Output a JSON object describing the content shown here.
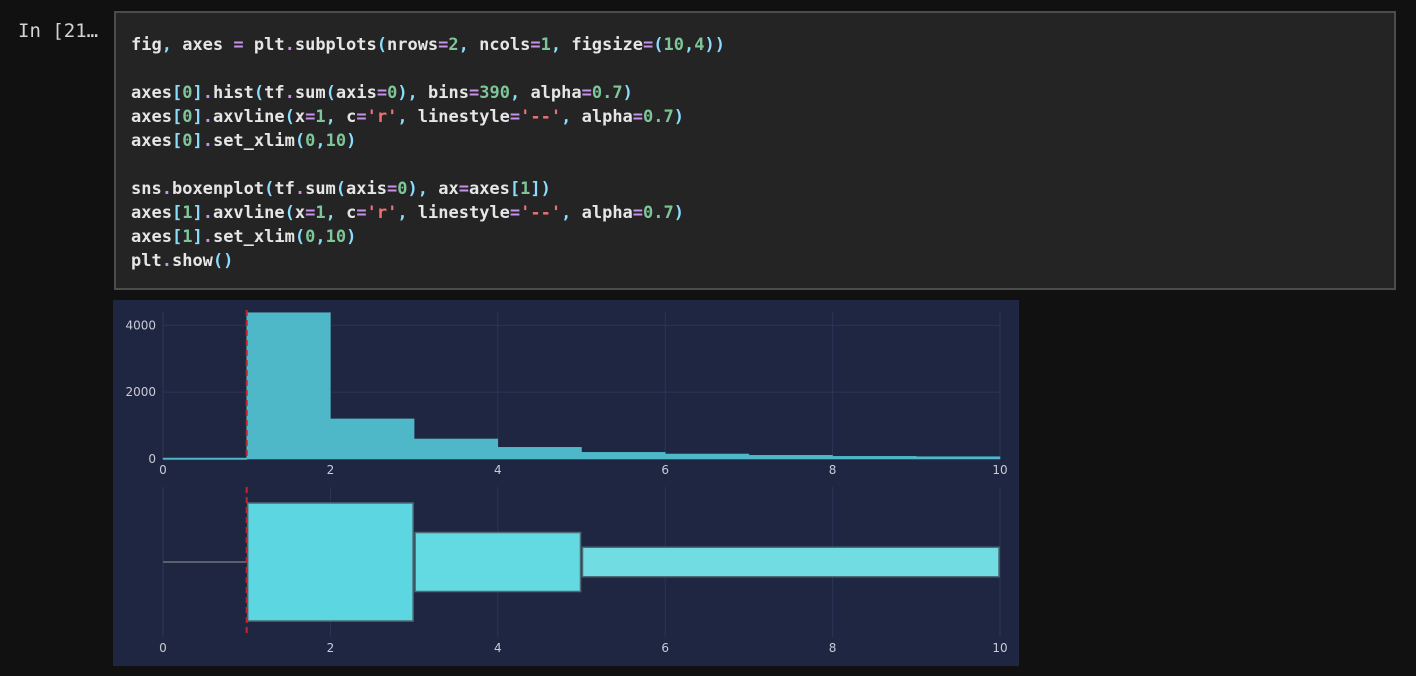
{
  "cell": {
    "prompt": "In [21…",
    "code_lines": [
      [
        [
          "v",
          "fig"
        ],
        [
          "p",
          ", "
        ],
        [
          "v",
          "axes "
        ],
        [
          "o",
          "="
        ],
        [
          "v",
          " plt"
        ],
        [
          "o",
          "."
        ],
        [
          "v",
          "subplots"
        ],
        [
          "p",
          "("
        ],
        [
          "v",
          "nrows"
        ],
        [
          "o",
          "="
        ],
        [
          "n",
          "2"
        ],
        [
          "p",
          ", "
        ],
        [
          "v",
          "ncols"
        ],
        [
          "o",
          "="
        ],
        [
          "n",
          "1"
        ],
        [
          "p",
          ", "
        ],
        [
          "v",
          "figsize"
        ],
        [
          "o",
          "="
        ],
        [
          "p",
          "("
        ],
        [
          "n",
          "10"
        ],
        [
          "p",
          ","
        ],
        [
          "n",
          "4"
        ],
        [
          "p",
          "))"
        ]
      ],
      [],
      [
        [
          "v",
          "axes"
        ],
        [
          "p",
          "["
        ],
        [
          "n",
          "0"
        ],
        [
          "p",
          "]"
        ],
        [
          "o",
          "."
        ],
        [
          "v",
          "hist"
        ],
        [
          "p",
          "("
        ],
        [
          "v",
          "tf"
        ],
        [
          "o",
          "."
        ],
        [
          "v",
          "sum"
        ],
        [
          "p",
          "("
        ],
        [
          "v",
          "axis"
        ],
        [
          "o",
          "="
        ],
        [
          "n",
          "0"
        ],
        [
          "p",
          "), "
        ],
        [
          "v",
          "bins"
        ],
        [
          "o",
          "="
        ],
        [
          "n",
          "390"
        ],
        [
          "p",
          ", "
        ],
        [
          "v",
          "alpha"
        ],
        [
          "o",
          "="
        ],
        [
          "n",
          "0.7"
        ],
        [
          "p",
          ")"
        ]
      ],
      [
        [
          "v",
          "axes"
        ],
        [
          "p",
          "["
        ],
        [
          "n",
          "0"
        ],
        [
          "p",
          "]"
        ],
        [
          "o",
          "."
        ],
        [
          "v",
          "axvline"
        ],
        [
          "p",
          "("
        ],
        [
          "v",
          "x"
        ],
        [
          "o",
          "="
        ],
        [
          "n",
          "1"
        ],
        [
          "p",
          ", "
        ],
        [
          "v",
          "c"
        ],
        [
          "o",
          "="
        ],
        [
          "s",
          "'r'"
        ],
        [
          "p",
          ", "
        ],
        [
          "v",
          "linestyle"
        ],
        [
          "o",
          "="
        ],
        [
          "s",
          "'--'"
        ],
        [
          "p",
          ", "
        ],
        [
          "v",
          "alpha"
        ],
        [
          "o",
          "="
        ],
        [
          "n",
          "0.7"
        ],
        [
          "p",
          ")"
        ]
      ],
      [
        [
          "v",
          "axes"
        ],
        [
          "p",
          "["
        ],
        [
          "n",
          "0"
        ],
        [
          "p",
          "]"
        ],
        [
          "o",
          "."
        ],
        [
          "v",
          "set_xlim"
        ],
        [
          "p",
          "("
        ],
        [
          "n",
          "0"
        ],
        [
          "p",
          ","
        ],
        [
          "n",
          "10"
        ],
        [
          "p",
          ")"
        ]
      ],
      [],
      [
        [
          "v",
          "sns"
        ],
        [
          "o",
          "."
        ],
        [
          "v",
          "boxenplot"
        ],
        [
          "p",
          "("
        ],
        [
          "v",
          "tf"
        ],
        [
          "o",
          "."
        ],
        [
          "v",
          "sum"
        ],
        [
          "p",
          "("
        ],
        [
          "v",
          "axis"
        ],
        [
          "o",
          "="
        ],
        [
          "n",
          "0"
        ],
        [
          "p",
          "), "
        ],
        [
          "v",
          "ax"
        ],
        [
          "o",
          "="
        ],
        [
          "v",
          "axes"
        ],
        [
          "p",
          "["
        ],
        [
          "n",
          "1"
        ],
        [
          "p",
          "])"
        ]
      ],
      [
        [
          "v",
          "axes"
        ],
        [
          "p",
          "["
        ],
        [
          "n",
          "1"
        ],
        [
          "p",
          "]"
        ],
        [
          "o",
          "."
        ],
        [
          "v",
          "axvline"
        ],
        [
          "p",
          "("
        ],
        [
          "v",
          "x"
        ],
        [
          "o",
          "="
        ],
        [
          "n",
          "1"
        ],
        [
          "p",
          ", "
        ],
        [
          "v",
          "c"
        ],
        [
          "o",
          "="
        ],
        [
          "s",
          "'r'"
        ],
        [
          "p",
          ", "
        ],
        [
          "v",
          "linestyle"
        ],
        [
          "o",
          "="
        ],
        [
          "s",
          "'--'"
        ],
        [
          "p",
          ", "
        ],
        [
          "v",
          "alpha"
        ],
        [
          "o",
          "="
        ],
        [
          "n",
          "0.7"
        ],
        [
          "p",
          ")"
        ]
      ],
      [
        [
          "v",
          "axes"
        ],
        [
          "p",
          "["
        ],
        [
          "n",
          "1"
        ],
        [
          "p",
          "]"
        ],
        [
          "o",
          "."
        ],
        [
          "v",
          "set_xlim"
        ],
        [
          "p",
          "("
        ],
        [
          "n",
          "0"
        ],
        [
          "p",
          ","
        ],
        [
          "n",
          "10"
        ],
        [
          "p",
          ")"
        ]
      ],
      [
        [
          "v",
          "plt"
        ],
        [
          "o",
          "."
        ],
        [
          "v",
          "show"
        ],
        [
          "p",
          "()"
        ]
      ]
    ]
  },
  "colors": {
    "hist_fill": "#4fb8c8",
    "boxen_1": "#5cd6e0",
    "boxen_2": "#63d9e1",
    "boxen_3": "#71dde3",
    "vline": "#c0272d",
    "grid": "#2c3556",
    "median": "#3b4a5a",
    "whisker": "#5a5f6a"
  },
  "chart_data": [
    {
      "type": "bar",
      "x_ticks": [
        "0",
        "2",
        "4",
        "6",
        "8",
        "10"
      ],
      "y_ticks": [
        "0",
        "2000",
        "4000"
      ],
      "xlim": [
        0,
        10
      ],
      "ylim": [
        0,
        4400
      ],
      "bins": [
        {
          "x0": 0,
          "x1": 1,
          "value": 30
        },
        {
          "x0": 1,
          "x1": 2,
          "value": 4380
        },
        {
          "x0": 2,
          "x1": 3,
          "value": 1200
        },
        {
          "x0": 3,
          "x1": 4,
          "value": 600
        },
        {
          "x0": 4,
          "x1": 5,
          "value": 350
        },
        {
          "x0": 5,
          "x1": 6,
          "value": 200
        },
        {
          "x0": 6,
          "x1": 7,
          "value": 150
        },
        {
          "x0": 7,
          "x1": 8,
          "value": 110
        },
        {
          "x0": 8,
          "x1": 9,
          "value": 80
        },
        {
          "x0": 9,
          "x1": 10,
          "value": 70
        }
      ],
      "vline_x": 1
    },
    {
      "type": "boxen",
      "x_ticks": [
        "0",
        "2",
        "4",
        "6",
        "8",
        "10"
      ],
      "xlim": [
        0,
        10
      ],
      "whisker": [
        0,
        1
      ],
      "boxes": [
        {
          "x0": 1,
          "x1": 3,
          "spread": 1.0
        },
        {
          "x0": 3,
          "x1": 5,
          "spread": 0.5
        },
        {
          "x0": 5,
          "x1": 10,
          "spread": 0.25
        }
      ],
      "median_x": 2,
      "vline_x": 1
    }
  ]
}
